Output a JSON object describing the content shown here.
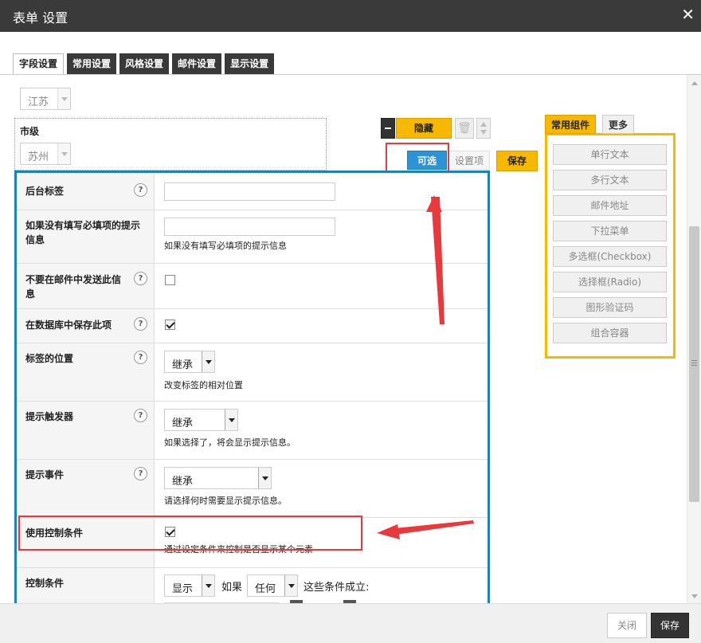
{
  "window": {
    "title": "表单 设置",
    "close_glyph": "✕"
  },
  "tabs": [
    {
      "label": "字段设置",
      "active": true
    },
    {
      "label": "常用设置"
    },
    {
      "label": "风格设置"
    },
    {
      "label": "邮件设置"
    },
    {
      "label": "显示设置"
    }
  ],
  "province_select": {
    "value": "江苏"
  },
  "city_field": {
    "label": "市级",
    "value": "苏州"
  },
  "field_controls": {
    "hide_label": "隐藏",
    "optional_label": "可选",
    "settings_label": "设置项",
    "save_label": "保存"
  },
  "settings": {
    "backend_label": {
      "label": "后台标签"
    },
    "required_hint": {
      "label": "如果没有填写必填项的提示信息",
      "desc": "如果没有填写必填项的提示信息"
    },
    "no_email": {
      "label": "不要在邮件中发送此信息"
    },
    "save_db": {
      "label": "在数据库中保存此项"
    },
    "label_pos": {
      "label": "标签的位置",
      "value": "继承",
      "desc": "改变标签的相对位置"
    },
    "tip_trigger": {
      "label": "提示触发器",
      "value": "继承",
      "desc": "如果选择了，将会显示提示信息。"
    },
    "tip_event": {
      "label": "提示事件",
      "value": "继承",
      "desc": "请选择何时需要显示提示信息。"
    },
    "use_condition": {
      "label": "使用控制条件",
      "desc": "通过设定条件来控制是否显示某个元素"
    },
    "condition": {
      "label": "控制条件",
      "show_value": "显示",
      "if_text": "如果",
      "any_value": "任何",
      "suffix": "这些条件成立:"
    }
  },
  "help_glyph": "?",
  "sidebar": {
    "tabs": [
      {
        "label": "常用组件",
        "active": true
      },
      {
        "label": "更多"
      }
    ],
    "components": [
      "单行文本",
      "多行文本",
      "邮件地址",
      "下拉菜单",
      "多选框(Checkbox)",
      "选择框(Radio)",
      "图形验证码",
      "组合容器"
    ]
  },
  "footer": {
    "close_label": "关闭",
    "save_label": "保存"
  },
  "colors": {
    "accent_blue": "#1f7fc0",
    "accent_yellow": "#f7b800",
    "annotation_red": "#e8393c"
  },
  "icons": {
    "trash": "trash-icon",
    "minus": "minus-icon",
    "up_down": "up-down-icon",
    "help": "help-icon"
  }
}
